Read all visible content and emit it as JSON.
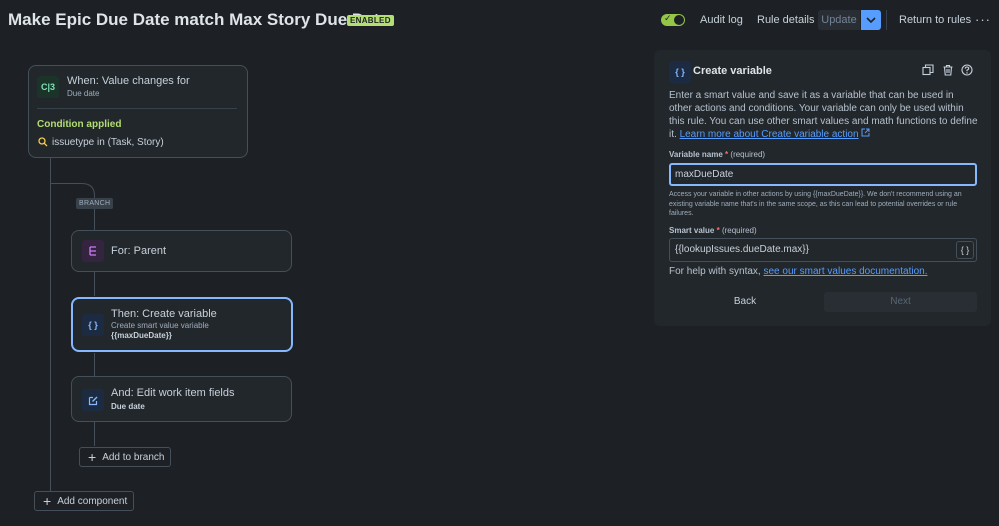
{
  "header": {
    "title": "Make Epic Due Date match Max Story Due Date",
    "status_badge": "ENABLED",
    "audit_log": "Audit log",
    "rule_details": "Rule details",
    "update": "Update",
    "return_to_rules": "Return to rules",
    "more": "···"
  },
  "trigger": {
    "icon_text": "C|3",
    "title": "When: Value changes for",
    "field": "Due date",
    "condition_label": "Condition applied",
    "condition": "issuetype in (Task, Story)"
  },
  "branch": {
    "tag": "BRANCH",
    "title": "For: Parent"
  },
  "create_variable_step": {
    "icon_text": "{ }",
    "title": "Then: Create variable",
    "subtitle": "Create smart value variable",
    "value": "{{maxDueDate}}"
  },
  "edit_step": {
    "title": "And: Edit work item fields",
    "field": "Due date"
  },
  "add_to_branch": "Add to branch",
  "add_component": "Add component",
  "panel": {
    "icon_text": "{ }",
    "title": "Create variable",
    "description": "Enter a smart value and save it as a variable that can be used in other actions and conditions. Your variable can only be used within this rule. You can use other smart values and math functions to define it.",
    "learn_more": "Learn more about Create variable action",
    "variable_name_label": "Variable name",
    "required_mark": "*",
    "required_text": "(required)",
    "variable_name_value": "maxDueDate",
    "variable_help": "Access your variable in other actions by using {{maxDueDate}}. We don't recommend using an existing variable name that's in the same scope, as this can lead to potential overrides or rule failures.",
    "smart_value_label": "Smart value",
    "smart_value": "{{lookupIssues.dueDate.max}}",
    "smart_btn": "{ }",
    "syntax_help": "For help with syntax,",
    "syntax_link": "see our smart values documentation.",
    "back": "Back",
    "next": "Next"
  },
  "colors": {
    "background": "#1d2125",
    "accent": "#579dff",
    "enabled": "#b3df72",
    "selected_border": "#85b8ff"
  }
}
